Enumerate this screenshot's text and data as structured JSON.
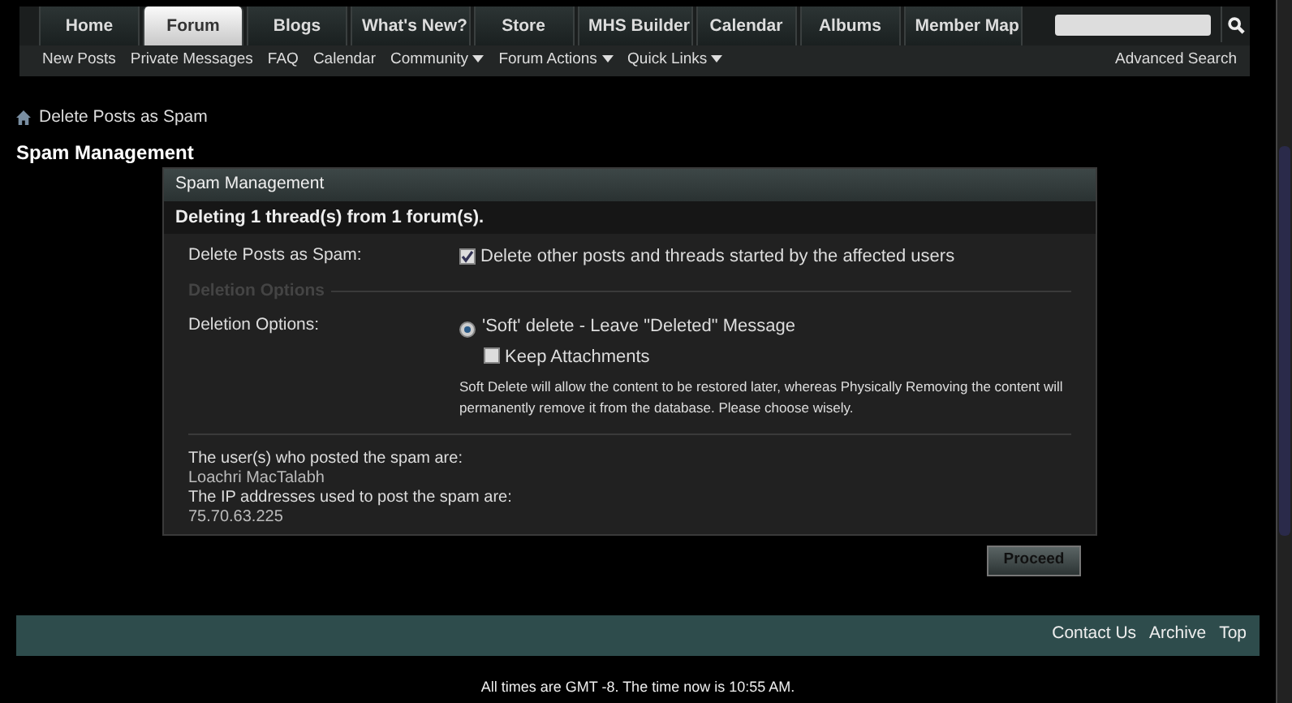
{
  "nav_tabs": [
    {
      "label": "Home",
      "selected": false
    },
    {
      "label": "Forum",
      "selected": true
    },
    {
      "label": "Blogs",
      "selected": false
    },
    {
      "label": "What's New?",
      "selected": false
    },
    {
      "label": "Store",
      "selected": false
    },
    {
      "label": "MHS Builder",
      "selected": false
    },
    {
      "label": "Calendar",
      "selected": false
    },
    {
      "label": "Albums",
      "selected": false
    },
    {
      "label": "Member Map",
      "selected": false
    }
  ],
  "sub_nav": [
    {
      "label": "New Posts",
      "dropdown": false
    },
    {
      "label": "Private Messages",
      "dropdown": false
    },
    {
      "label": "FAQ",
      "dropdown": false
    },
    {
      "label": "Calendar",
      "dropdown": false
    },
    {
      "label": "Community",
      "dropdown": true
    },
    {
      "label": "Forum Actions",
      "dropdown": true
    },
    {
      "label": "Quick Links",
      "dropdown": true
    }
  ],
  "advanced_search": "Advanced Search",
  "breadcrumb": "Delete Posts as Spam",
  "page_title": "Spam Management",
  "dialog": {
    "title": "Spam Management",
    "subtitle": "Deleting 1 thread(s) from 1 forum(s).",
    "spam_label": "Delete Posts as Spam:",
    "spam_option": {
      "label": "Delete other posts and threads started by the affected users",
      "checked": true
    },
    "legend": "Deletion Options",
    "options_label": "Deletion Options:",
    "delete_option": {
      "label": "'Soft' delete - Leave \"Deleted\" Message",
      "selected": true
    },
    "keep_attachments": {
      "label": "Keep Attachments",
      "checked": false
    },
    "help": "Soft Delete will allow the content to be restored later, whereas Physically Removing the content will permanently remove it from the database. Please choose wisely.",
    "info": [
      {
        "kind": "label",
        "text": "The user(s) who posted the spam are:"
      },
      {
        "kind": "value",
        "text": "Loachri MacTalabh"
      },
      {
        "kind": "label",
        "text": "The IP addresses used to post the spam are:"
      },
      {
        "kind": "value",
        "text": "75.70.63.225"
      }
    ]
  },
  "proceed": "Proceed",
  "footer_links": [
    "Contact Us",
    "Archive",
    "Top"
  ],
  "time_note": "All times are GMT -8. The time now is 10:55 AM."
}
